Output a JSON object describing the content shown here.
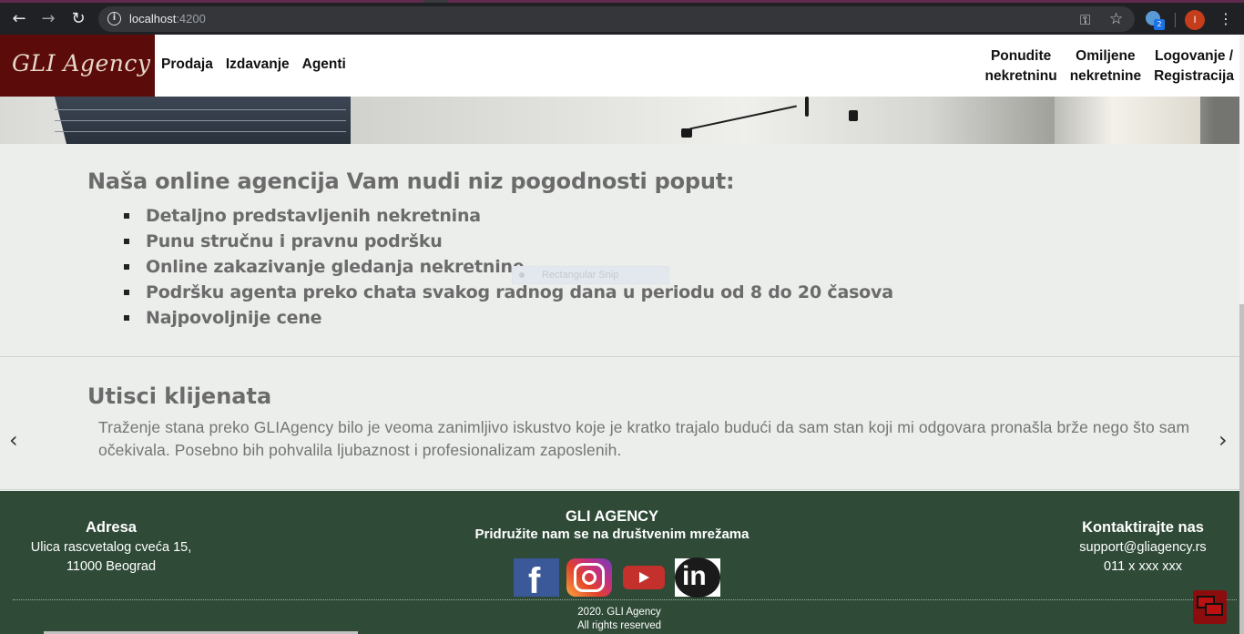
{
  "browser": {
    "url_host": "localhost",
    "url_port": ":4200",
    "profile_initial": "I",
    "extension_badge": "2",
    "icons": [
      "back-icon",
      "forward-icon",
      "reload-icon",
      "info-icon",
      "key-icon",
      "star-icon",
      "extension-icon",
      "menu-icon"
    ]
  },
  "header": {
    "logo": "GLI Agency",
    "nav_left": [
      "Prodaja",
      "Izdavanje",
      "Agenti"
    ],
    "nav_right": [
      {
        "line1": "Ponudite",
        "line2": "nekretninu"
      },
      {
        "line1": "Omiljene",
        "line2": "nekretnine"
      },
      {
        "line1": "Logovanje /",
        "line2": "Registracija"
      }
    ]
  },
  "benefits": {
    "title": "Naša online agencija Vam nudi niz pogodnosti poput:",
    "items": [
      "Detaljno predstavljenih nekretnina",
      "Punu stručnu i pravnu podršku",
      "Online zakazivanje gledanja nekretnine",
      "Podršku agenta preko chata svakog radnog dana u periodu od 8 do 20 časova",
      "Najpovoljnije cene"
    ],
    "overlay_label": "Rectangular Snip"
  },
  "testimonials": {
    "title": "Utisci klijenata",
    "text": "Traženje stana preko GLIAgency bilo je veoma zanimljivo iskustvo koje je kratko trajalo budući da sam stan koji mi odgovara pronašla brže nego što sam očekivala. Posebno bih pohvalila ljubaznost i profesionalizam zaposlenih.",
    "prev": "‹",
    "next": "›"
  },
  "footer": {
    "address_title": "Adresa",
    "address_line1": "Ulica rascvetalog cveća 15,",
    "address_line2": "11000 Beograd",
    "brand": "GLI AGENCY",
    "social_title": "Pridružite nam se na društvenim mrežama",
    "contact_title": "Kontaktirajte nas",
    "email": "support@gliagency.rs",
    "phone": "011 x xxx xxx",
    "copy_line1": "2020. GLI Agency",
    "copy_line2": "All rights reserved"
  },
  "colors": {
    "brand": "#5c0b0b",
    "footer_bg": "#2f4a37",
    "page_bg": "#ebeeea"
  }
}
